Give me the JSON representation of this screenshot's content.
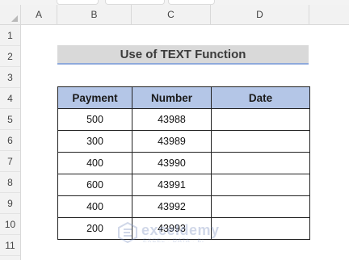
{
  "columns": [
    "A",
    "B",
    "C",
    "D"
  ],
  "rows": [
    "1",
    "2",
    "3",
    "4",
    "5",
    "6",
    "7",
    "8",
    "9",
    "10",
    "11"
  ],
  "title": "Use of TEXT Function",
  "table": {
    "headers": [
      "Payment",
      "Number",
      "Date"
    ],
    "rows": [
      {
        "payment": "500",
        "number": "43988",
        "date": ""
      },
      {
        "payment": "300",
        "number": "43989",
        "date": ""
      },
      {
        "payment": "400",
        "number": "43990",
        "date": ""
      },
      {
        "payment": "600",
        "number": "43991",
        "date": ""
      },
      {
        "payment": "400",
        "number": "43992",
        "date": ""
      },
      {
        "payment": "200",
        "number": "43993",
        "date": ""
      }
    ]
  },
  "watermark": {
    "name": "exceldemy",
    "tagline": "EXCEL · DATA · BI"
  },
  "colors": {
    "header_fill": "#b4c6e7",
    "title_fill": "#d9d9d9",
    "title_underline": "#8ea9db"
  }
}
